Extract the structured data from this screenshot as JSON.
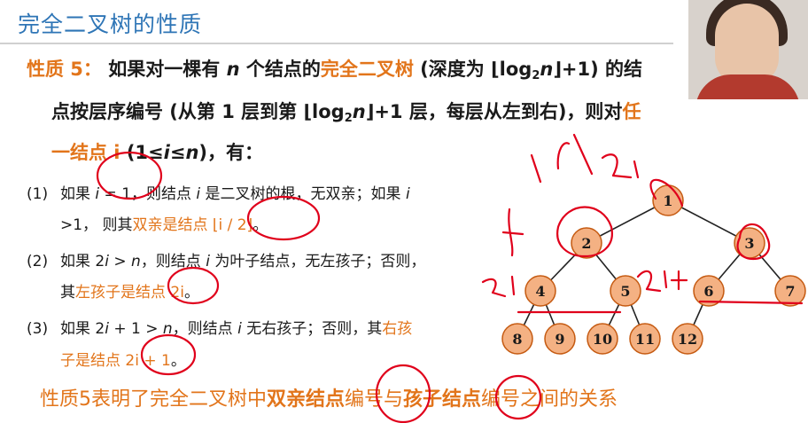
{
  "header": {
    "title": "完全二叉树的性质"
  },
  "property": {
    "label": "性质 5：",
    "line1_a": "如果对一棵有 ",
    "line1_n": "n",
    "line1_b": " 个结点的",
    "line1_hl": "完全二叉树",
    "line1_c": " (深度为 ⌊log",
    "line1_sub": "2",
    "line1_n2": "n",
    "line1_d": "⌋+1) 的结",
    "line2_a": "点按层序编号 (从第 1 层到第 ⌊log",
    "line2_sub": "2",
    "line2_n": "n",
    "line2_b": "⌋+1 层，每层从左到右)，则对",
    "line2_hl": "任",
    "line3_hl": "一结点 i",
    "line3_a": " (1≤",
    "line3_i": "i",
    "line3_b": "≤",
    "line3_n": "n",
    "line3_c": ")，有："
  },
  "items": [
    {
      "num": "(1)",
      "a": "如果 ",
      "b": "i",
      "c": " = 1，则结点 ",
      "d": "i",
      "e": " 是二叉树的根，无双亲；如果 ",
      "f": "i",
      "cont_a": ">1，  则其",
      "cont_hl": "双亲是结点 ⌊i / 2⌋",
      "cont_end": "。"
    },
    {
      "num": "(2)",
      "a": "如果 2",
      "b": "i",
      "c": " > ",
      "d": "n",
      "e": "，则结点 ",
      "f": "i",
      "g": " 为叶子结点，无左孩子；否则，",
      "cont_a": "其",
      "cont_hl": "左孩子是结点 2i",
      "cont_end": "。"
    },
    {
      "num": "(3)",
      "a": "如果 2",
      "b": "i",
      "c": " + 1 > ",
      "d": "n",
      "e": "，则结点 ",
      "f": "i",
      "g": " 无右孩子；否则，其",
      "g_hl": "右孩",
      "cont_hl": "子是结点 2i + 1",
      "cont_end": "。"
    }
  ],
  "summary": {
    "a": "性质5表明了完全二叉树中",
    "b": "双亲结点",
    "c": "编号与",
    "d": "孩子结点",
    "e": "编号之间的关系"
  },
  "tree": {
    "nodes": [
      "1",
      "2",
      "3",
      "4",
      "5",
      "6",
      "7",
      "8",
      "9",
      "10",
      "11",
      "12"
    ],
    "node_fill": "#f4b183",
    "node_stroke": "#c55a11"
  },
  "annotations": {
    "a1": "i/2",
    "a2": "2i",
    "a3": "2i+1",
    "a4": "2i"
  },
  "colors": {
    "accent": "#e2751b",
    "title": "#2e75b6",
    "ink": "#e0001b"
  }
}
